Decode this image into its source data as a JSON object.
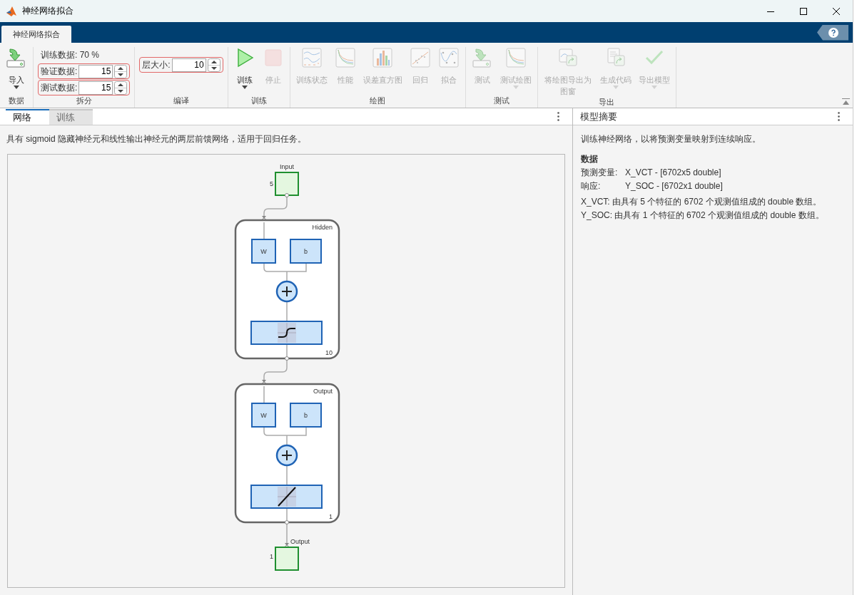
{
  "window": {
    "title": "神经网络拟合"
  },
  "app_tabs": [
    {
      "label": "神经网络拟合",
      "selected": true
    }
  ],
  "toolstrip": {
    "groups": [
      {
        "title": "数据",
        "items": [
          {
            "kind": "button",
            "label": "导入",
            "disabled": false,
            "dropdown": true
          }
        ]
      },
      {
        "title": "拆分",
        "items": [
          {
            "kind": "text",
            "label": "训练数据: 70 %"
          },
          {
            "kind": "spinner",
            "label": "验证数据:",
            "value": "15",
            "highlighted": true
          },
          {
            "kind": "spinner",
            "label": "测试数据:",
            "value": "15",
            "highlighted": true
          }
        ]
      },
      {
        "title": "编译",
        "items": [
          {
            "kind": "spinner",
            "label": "层大小:",
            "value": "10",
            "highlighted": true
          }
        ]
      },
      {
        "title": "训练",
        "items": [
          {
            "kind": "button",
            "label": "训练",
            "disabled": false,
            "dropdown": true
          },
          {
            "kind": "button",
            "label": "停止",
            "disabled": true,
            "dropdown": false
          }
        ]
      },
      {
        "title": "绘图",
        "items": [
          {
            "kind": "button",
            "label": "训练状态",
            "disabled": true,
            "dropdown": false
          },
          {
            "kind": "button",
            "label": "性能",
            "disabled": true,
            "dropdown": false
          },
          {
            "kind": "button",
            "label": "误差直方图",
            "disabled": true,
            "dropdown": false
          },
          {
            "kind": "button",
            "label": "回归",
            "disabled": true,
            "dropdown": false
          },
          {
            "kind": "button",
            "label": "拟合",
            "disabled": true,
            "dropdown": false
          }
        ]
      },
      {
        "title": "测试",
        "items": [
          {
            "kind": "button",
            "label": "测试",
            "disabled": true,
            "dropdown": false
          },
          {
            "kind": "button",
            "label": "测试绘图",
            "disabled": true,
            "dropdown": true
          }
        ]
      },
      {
        "title": "导出",
        "items": [
          {
            "kind": "button",
            "label": "将绘图导出为图窗",
            "disabled": true,
            "dropdown": false
          },
          {
            "kind": "button",
            "label": "生成代码",
            "disabled": true,
            "dropdown": true
          },
          {
            "kind": "button",
            "label": "导出模型",
            "disabled": true,
            "dropdown": true
          }
        ]
      }
    ]
  },
  "doc_tabs": [
    {
      "label": "网络",
      "selected": true
    },
    {
      "label": "训练",
      "selected": false
    }
  ],
  "network": {
    "description": "具有 sigmoid 隐藏神经元和线性输出神经元的两层前馈网络，适用于回归任务。",
    "input": {
      "label": "Input",
      "size": "5"
    },
    "layers": [
      {
        "name": "Hidden",
        "size": "10",
        "weight": "W",
        "bias": "b",
        "kind": "sigmoid"
      },
      {
        "name": "Output",
        "size": "1",
        "weight": "W",
        "bias": "b",
        "kind": "linear"
      }
    ],
    "output": {
      "label": "Output",
      "size": "1"
    }
  },
  "summary": {
    "title": "模型摘要",
    "intro": "训练神经网络，以将预测变量映射到连续响应。",
    "section": "数据",
    "fields": [
      {
        "label": "预测变量:",
        "value": "X_VCT - [6702x5 double]"
      },
      {
        "label": "响应:",
        "value": "Y_SOC - [6702x1 double]"
      }
    ],
    "notes": [
      "X_VCT: 由具有 5 个特征的 6702 个观测值组成的 double 数组。",
      "Y_SOC: 由具有 1 个特征的 6702 个观测值组成的 double 数组。"
    ]
  }
}
